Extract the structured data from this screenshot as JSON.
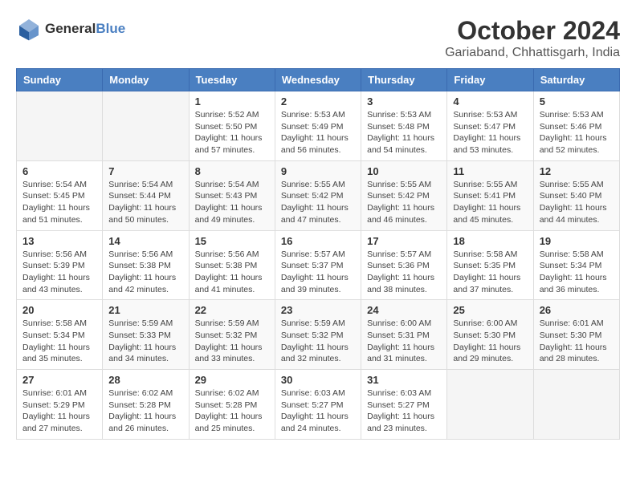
{
  "header": {
    "logo_line1": "General",
    "logo_line2": "Blue",
    "title": "October 2024",
    "subtitle": "Gariaband, Chhattisgarh, India"
  },
  "calendar": {
    "headers": [
      "Sunday",
      "Monday",
      "Tuesday",
      "Wednesday",
      "Thursday",
      "Friday",
      "Saturday"
    ],
    "weeks": [
      [
        {
          "day": "",
          "info": ""
        },
        {
          "day": "",
          "info": ""
        },
        {
          "day": "1",
          "info": "Sunrise: 5:52 AM\nSunset: 5:50 PM\nDaylight: 11 hours and 57 minutes."
        },
        {
          "day": "2",
          "info": "Sunrise: 5:53 AM\nSunset: 5:49 PM\nDaylight: 11 hours and 56 minutes."
        },
        {
          "day": "3",
          "info": "Sunrise: 5:53 AM\nSunset: 5:48 PM\nDaylight: 11 hours and 54 minutes."
        },
        {
          "day": "4",
          "info": "Sunrise: 5:53 AM\nSunset: 5:47 PM\nDaylight: 11 hours and 53 minutes."
        },
        {
          "day": "5",
          "info": "Sunrise: 5:53 AM\nSunset: 5:46 PM\nDaylight: 11 hours and 52 minutes."
        }
      ],
      [
        {
          "day": "6",
          "info": "Sunrise: 5:54 AM\nSunset: 5:45 PM\nDaylight: 11 hours and 51 minutes."
        },
        {
          "day": "7",
          "info": "Sunrise: 5:54 AM\nSunset: 5:44 PM\nDaylight: 11 hours and 50 minutes."
        },
        {
          "day": "8",
          "info": "Sunrise: 5:54 AM\nSunset: 5:43 PM\nDaylight: 11 hours and 49 minutes."
        },
        {
          "day": "9",
          "info": "Sunrise: 5:55 AM\nSunset: 5:42 PM\nDaylight: 11 hours and 47 minutes."
        },
        {
          "day": "10",
          "info": "Sunrise: 5:55 AM\nSunset: 5:42 PM\nDaylight: 11 hours and 46 minutes."
        },
        {
          "day": "11",
          "info": "Sunrise: 5:55 AM\nSunset: 5:41 PM\nDaylight: 11 hours and 45 minutes."
        },
        {
          "day": "12",
          "info": "Sunrise: 5:55 AM\nSunset: 5:40 PM\nDaylight: 11 hours and 44 minutes."
        }
      ],
      [
        {
          "day": "13",
          "info": "Sunrise: 5:56 AM\nSunset: 5:39 PM\nDaylight: 11 hours and 43 minutes."
        },
        {
          "day": "14",
          "info": "Sunrise: 5:56 AM\nSunset: 5:38 PM\nDaylight: 11 hours and 42 minutes."
        },
        {
          "day": "15",
          "info": "Sunrise: 5:56 AM\nSunset: 5:38 PM\nDaylight: 11 hours and 41 minutes."
        },
        {
          "day": "16",
          "info": "Sunrise: 5:57 AM\nSunset: 5:37 PM\nDaylight: 11 hours and 39 minutes."
        },
        {
          "day": "17",
          "info": "Sunrise: 5:57 AM\nSunset: 5:36 PM\nDaylight: 11 hours and 38 minutes."
        },
        {
          "day": "18",
          "info": "Sunrise: 5:58 AM\nSunset: 5:35 PM\nDaylight: 11 hours and 37 minutes."
        },
        {
          "day": "19",
          "info": "Sunrise: 5:58 AM\nSunset: 5:34 PM\nDaylight: 11 hours and 36 minutes."
        }
      ],
      [
        {
          "day": "20",
          "info": "Sunrise: 5:58 AM\nSunset: 5:34 PM\nDaylight: 11 hours and 35 minutes."
        },
        {
          "day": "21",
          "info": "Sunrise: 5:59 AM\nSunset: 5:33 PM\nDaylight: 11 hours and 34 minutes."
        },
        {
          "day": "22",
          "info": "Sunrise: 5:59 AM\nSunset: 5:32 PM\nDaylight: 11 hours and 33 minutes."
        },
        {
          "day": "23",
          "info": "Sunrise: 5:59 AM\nSunset: 5:32 PM\nDaylight: 11 hours and 32 minutes."
        },
        {
          "day": "24",
          "info": "Sunrise: 6:00 AM\nSunset: 5:31 PM\nDaylight: 11 hours and 31 minutes."
        },
        {
          "day": "25",
          "info": "Sunrise: 6:00 AM\nSunset: 5:30 PM\nDaylight: 11 hours and 29 minutes."
        },
        {
          "day": "26",
          "info": "Sunrise: 6:01 AM\nSunset: 5:30 PM\nDaylight: 11 hours and 28 minutes."
        }
      ],
      [
        {
          "day": "27",
          "info": "Sunrise: 6:01 AM\nSunset: 5:29 PM\nDaylight: 11 hours and 27 minutes."
        },
        {
          "day": "28",
          "info": "Sunrise: 6:02 AM\nSunset: 5:28 PM\nDaylight: 11 hours and 26 minutes."
        },
        {
          "day": "29",
          "info": "Sunrise: 6:02 AM\nSunset: 5:28 PM\nDaylight: 11 hours and 25 minutes."
        },
        {
          "day": "30",
          "info": "Sunrise: 6:03 AM\nSunset: 5:27 PM\nDaylight: 11 hours and 24 minutes."
        },
        {
          "day": "31",
          "info": "Sunrise: 6:03 AM\nSunset: 5:27 PM\nDaylight: 11 hours and 23 minutes."
        },
        {
          "day": "",
          "info": ""
        },
        {
          "day": "",
          "info": ""
        }
      ]
    ]
  }
}
